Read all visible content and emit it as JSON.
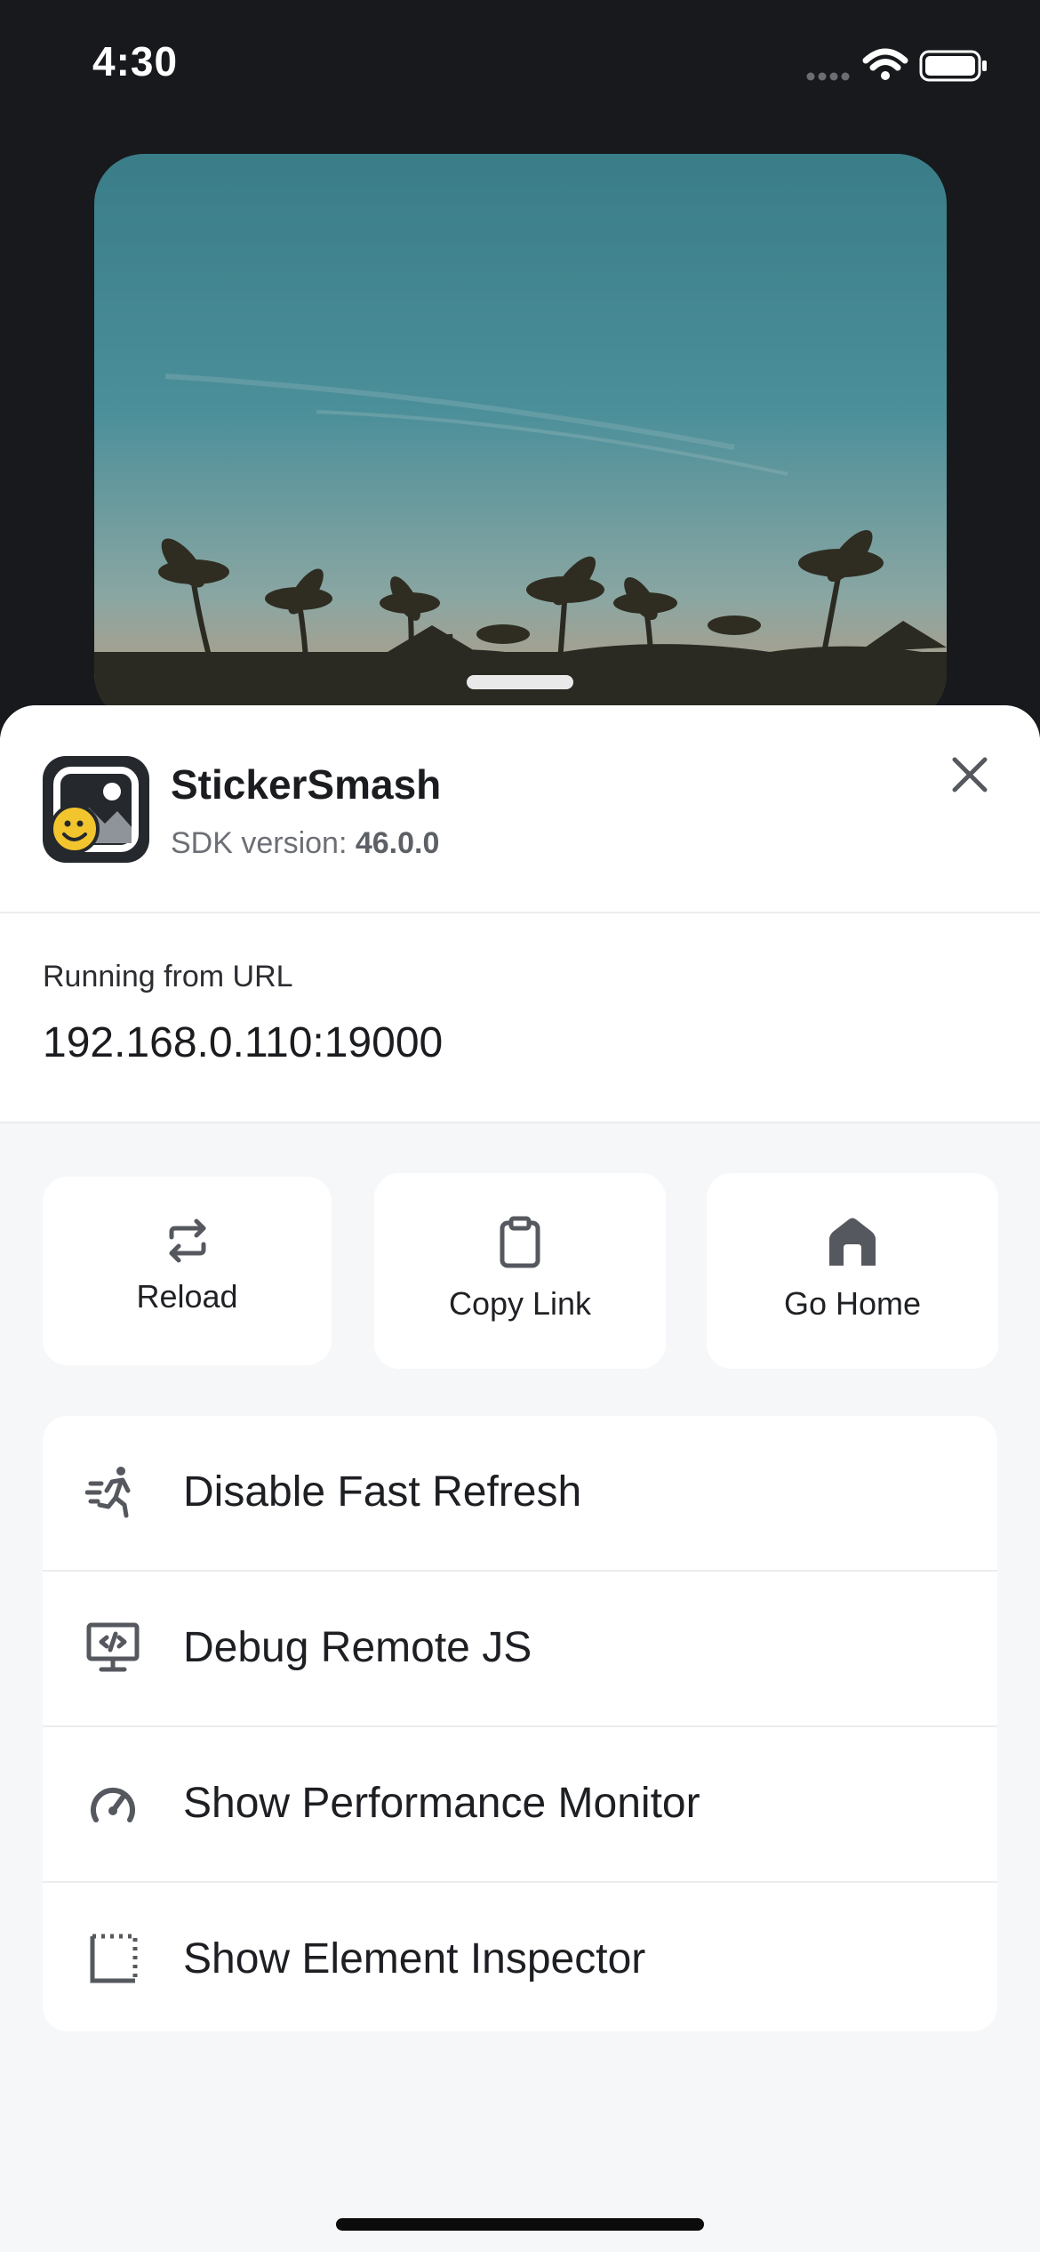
{
  "status_bar": {
    "time": "4:30",
    "icons": [
      "signal-dots-icon",
      "wifi-icon",
      "battery-icon"
    ]
  },
  "background": {
    "image": "tropical beach photo with palm trees"
  },
  "sheet": {
    "app": {
      "name": "StickerSmash",
      "sdk_label": "SDK version: ",
      "sdk_version": "46.0.0",
      "icon": "stickersmash-app-icon"
    },
    "close_icon": "close-icon",
    "url": {
      "label": "Running from URL",
      "value": "192.168.0.110:19000"
    },
    "actions": [
      {
        "label": "Reload",
        "icon": "reload-icon"
      },
      {
        "label": "Copy Link",
        "icon": "clipboard-icon"
      },
      {
        "label": "Go Home",
        "icon": "home-icon"
      }
    ],
    "menu": [
      {
        "label": "Disable Fast Refresh",
        "icon": "running-person-icon"
      },
      {
        "label": "Debug Remote JS",
        "icon": "monitor-debug-icon"
      },
      {
        "label": "Show Performance Monitor",
        "icon": "speedometer-icon"
      },
      {
        "label": "Show Element Inspector",
        "icon": "inspector-frame-icon"
      }
    ]
  },
  "colors": {
    "sheet_bg": "#f6f7f9",
    "card_bg": "#ffffff",
    "text": "#1b1c1f",
    "muted": "#6c6f75",
    "icon": "#55585e",
    "backdrop": "#17191d"
  }
}
